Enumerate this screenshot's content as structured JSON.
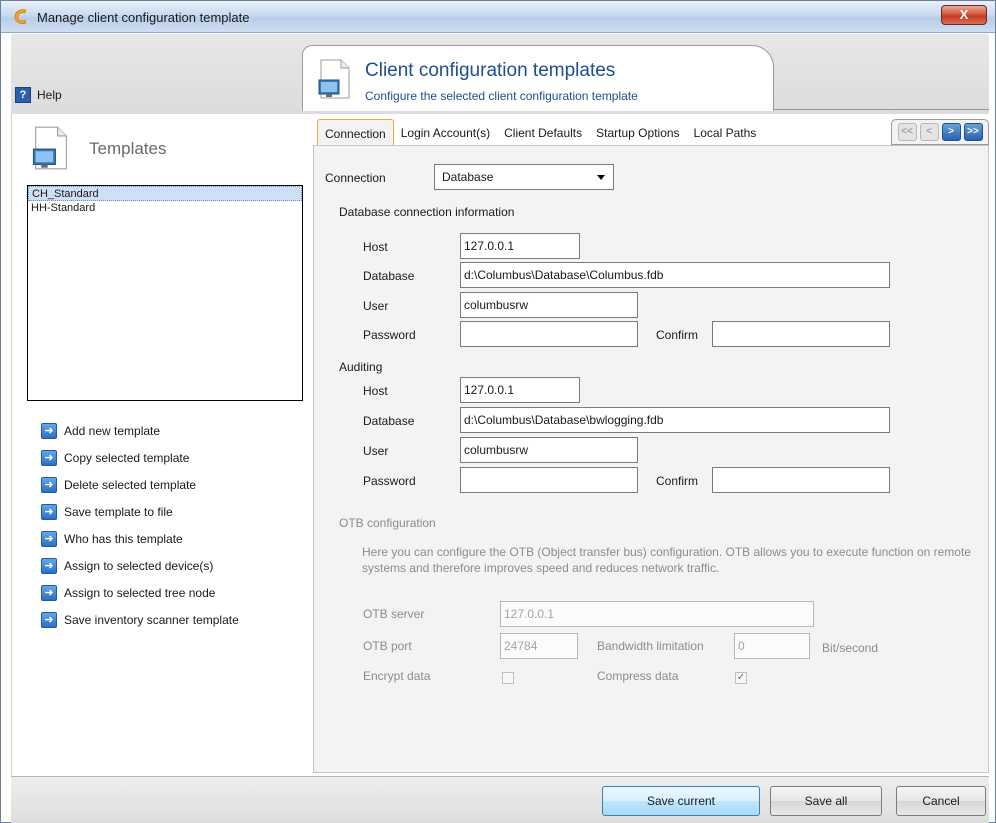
{
  "window": {
    "title": "Manage client configuration template",
    "close_label": "X"
  },
  "colors": {
    "title_blue": "#1f4c92",
    "accent_orange": "#e7a93c",
    "close_red": "#c43a1f"
  },
  "icons": [
    "client-logo-icon",
    "help-icon",
    "template-document-icon",
    "arrow-right-icon",
    "nav-first-icon",
    "nav-prev-icon",
    "nav-next-icon",
    "nav-last-icon",
    "dropdown-caret-icon",
    "checkbox-icon"
  ],
  "help": {
    "label": "Help",
    "icon": "?"
  },
  "header": {
    "title": "Client configuration templates",
    "subtitle": "Configure the selected client configuration template"
  },
  "templates": {
    "title": "Templates",
    "items": [
      "CH_Standard",
      "HH-Standard"
    ],
    "selected": "CH_Standard"
  },
  "actions": [
    "Add new template",
    "Copy selected template",
    "Delete selected template",
    "Save template to file",
    "Who has this template",
    "Assign to selected device(s)",
    "Assign to selected tree node",
    "Save inventory scanner template"
  ],
  "tabs": [
    "Connection",
    "Login Account(s)",
    "Client Defaults",
    "Startup Options",
    "Local Paths"
  ],
  "active_tab": "Connection",
  "tab_nav": {
    "first": "<<",
    "prev": "<",
    "next": ">",
    "last": ">>"
  },
  "connection": {
    "label": "Connection",
    "value": "Database",
    "db_section": "Database connection information",
    "db": {
      "host_label": "Host",
      "host": "127.0.0.1",
      "database_label": "Database",
      "database": "d:\\Columbus\\Database\\Columbus.fdb",
      "user_label": "User",
      "user": "columbusrw",
      "password_label": "Password",
      "password": "",
      "confirm_label": "Confirm",
      "confirm": ""
    },
    "auditing_section": "Auditing",
    "audit": {
      "host_label": "Host",
      "host": "127.0.0.1",
      "database_label": "Database",
      "database": "d:\\Columbus\\Database\\bwlogging.fdb",
      "user_label": "User",
      "user": "columbusrw",
      "password_label": "Password",
      "password": "",
      "confirm_label": "Confirm",
      "confirm": ""
    },
    "otb": {
      "section": "OTB configuration",
      "description": "Here you can configure the OTB (Object transfer bus) configuration. OTB allows you to execute function on remote systems and therefore improves speed and reduces network traffic.",
      "server_label": "OTB server",
      "server": "127.0.0.1",
      "port_label": "OTB port",
      "port": "24784",
      "bandwidth_label": "Bandwidth limitation",
      "bandwidth": "0",
      "bandwidth_unit": "Bit/second",
      "encrypt_label": "Encrypt data",
      "encrypt_checked": false,
      "compress_label": "Compress data",
      "compress_checked": true
    }
  },
  "buttons": {
    "save_current": "Save current",
    "save_all": "Save all",
    "cancel": "Cancel"
  }
}
